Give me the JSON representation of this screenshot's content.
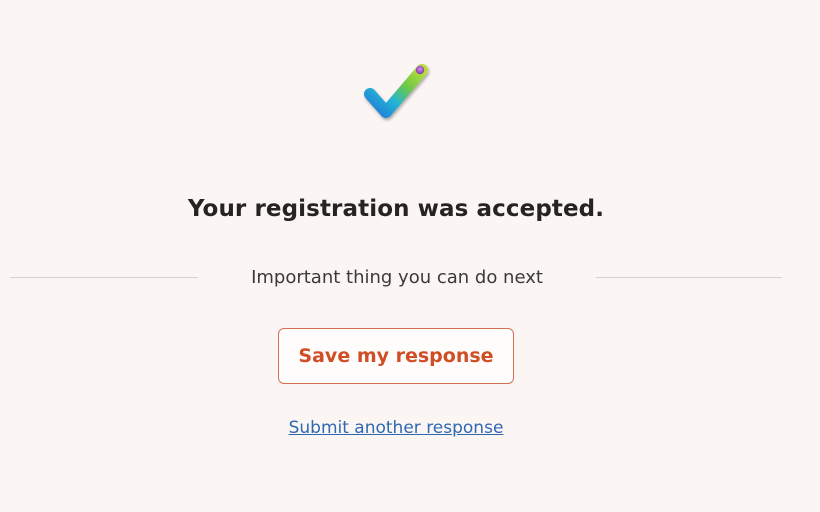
{
  "confirmation": {
    "icon": "checkmark-icon",
    "title": "Your registration was accepted."
  },
  "next_steps": {
    "label": "Important thing you can do next",
    "save_button_label": "Save my response",
    "submit_another_label": "Submit another response"
  },
  "colors": {
    "background": "#fbf6f4",
    "accent": "#d04e25",
    "link": "#2e68b0",
    "title": "#252423"
  }
}
